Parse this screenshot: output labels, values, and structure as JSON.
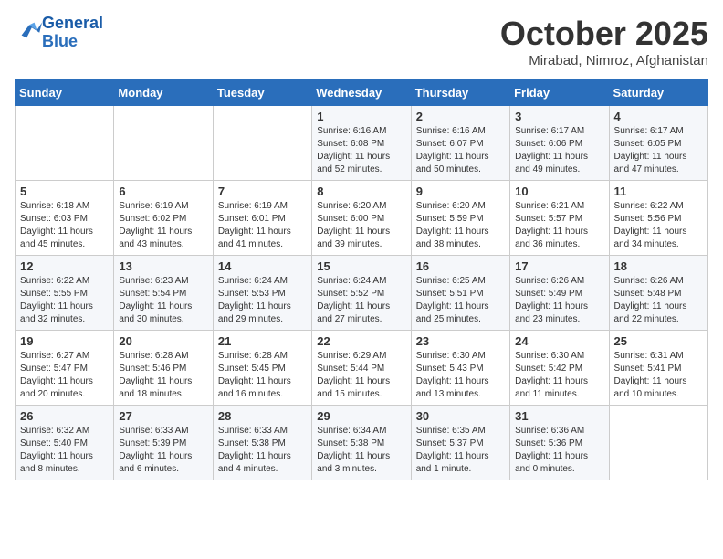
{
  "header": {
    "logo_line1": "General",
    "logo_line2": "Blue",
    "month": "October 2025",
    "location": "Mirabad, Nimroz, Afghanistan"
  },
  "weekdays": [
    "Sunday",
    "Monday",
    "Tuesday",
    "Wednesday",
    "Thursday",
    "Friday",
    "Saturday"
  ],
  "weeks": [
    [
      {
        "day": "",
        "info": ""
      },
      {
        "day": "",
        "info": ""
      },
      {
        "day": "",
        "info": ""
      },
      {
        "day": "1",
        "info": "Sunrise: 6:16 AM\nSunset: 6:08 PM\nDaylight: 11 hours\nand 52 minutes."
      },
      {
        "day": "2",
        "info": "Sunrise: 6:16 AM\nSunset: 6:07 PM\nDaylight: 11 hours\nand 50 minutes."
      },
      {
        "day": "3",
        "info": "Sunrise: 6:17 AM\nSunset: 6:06 PM\nDaylight: 11 hours\nand 49 minutes."
      },
      {
        "day": "4",
        "info": "Sunrise: 6:17 AM\nSunset: 6:05 PM\nDaylight: 11 hours\nand 47 minutes."
      }
    ],
    [
      {
        "day": "5",
        "info": "Sunrise: 6:18 AM\nSunset: 6:03 PM\nDaylight: 11 hours\nand 45 minutes."
      },
      {
        "day": "6",
        "info": "Sunrise: 6:19 AM\nSunset: 6:02 PM\nDaylight: 11 hours\nand 43 minutes."
      },
      {
        "day": "7",
        "info": "Sunrise: 6:19 AM\nSunset: 6:01 PM\nDaylight: 11 hours\nand 41 minutes."
      },
      {
        "day": "8",
        "info": "Sunrise: 6:20 AM\nSunset: 6:00 PM\nDaylight: 11 hours\nand 39 minutes."
      },
      {
        "day": "9",
        "info": "Sunrise: 6:20 AM\nSunset: 5:59 PM\nDaylight: 11 hours\nand 38 minutes."
      },
      {
        "day": "10",
        "info": "Sunrise: 6:21 AM\nSunset: 5:57 PM\nDaylight: 11 hours\nand 36 minutes."
      },
      {
        "day": "11",
        "info": "Sunrise: 6:22 AM\nSunset: 5:56 PM\nDaylight: 11 hours\nand 34 minutes."
      }
    ],
    [
      {
        "day": "12",
        "info": "Sunrise: 6:22 AM\nSunset: 5:55 PM\nDaylight: 11 hours\nand 32 minutes."
      },
      {
        "day": "13",
        "info": "Sunrise: 6:23 AM\nSunset: 5:54 PM\nDaylight: 11 hours\nand 30 minutes."
      },
      {
        "day": "14",
        "info": "Sunrise: 6:24 AM\nSunset: 5:53 PM\nDaylight: 11 hours\nand 29 minutes."
      },
      {
        "day": "15",
        "info": "Sunrise: 6:24 AM\nSunset: 5:52 PM\nDaylight: 11 hours\nand 27 minutes."
      },
      {
        "day": "16",
        "info": "Sunrise: 6:25 AM\nSunset: 5:51 PM\nDaylight: 11 hours\nand 25 minutes."
      },
      {
        "day": "17",
        "info": "Sunrise: 6:26 AM\nSunset: 5:49 PM\nDaylight: 11 hours\nand 23 minutes."
      },
      {
        "day": "18",
        "info": "Sunrise: 6:26 AM\nSunset: 5:48 PM\nDaylight: 11 hours\nand 22 minutes."
      }
    ],
    [
      {
        "day": "19",
        "info": "Sunrise: 6:27 AM\nSunset: 5:47 PM\nDaylight: 11 hours\nand 20 minutes."
      },
      {
        "day": "20",
        "info": "Sunrise: 6:28 AM\nSunset: 5:46 PM\nDaylight: 11 hours\nand 18 minutes."
      },
      {
        "day": "21",
        "info": "Sunrise: 6:28 AM\nSunset: 5:45 PM\nDaylight: 11 hours\nand 16 minutes."
      },
      {
        "day": "22",
        "info": "Sunrise: 6:29 AM\nSunset: 5:44 PM\nDaylight: 11 hours\nand 15 minutes."
      },
      {
        "day": "23",
        "info": "Sunrise: 6:30 AM\nSunset: 5:43 PM\nDaylight: 11 hours\nand 13 minutes."
      },
      {
        "day": "24",
        "info": "Sunrise: 6:30 AM\nSunset: 5:42 PM\nDaylight: 11 hours\nand 11 minutes."
      },
      {
        "day": "25",
        "info": "Sunrise: 6:31 AM\nSunset: 5:41 PM\nDaylight: 11 hours\nand 10 minutes."
      }
    ],
    [
      {
        "day": "26",
        "info": "Sunrise: 6:32 AM\nSunset: 5:40 PM\nDaylight: 11 hours\nand 8 minutes."
      },
      {
        "day": "27",
        "info": "Sunrise: 6:33 AM\nSunset: 5:39 PM\nDaylight: 11 hours\nand 6 minutes."
      },
      {
        "day": "28",
        "info": "Sunrise: 6:33 AM\nSunset: 5:38 PM\nDaylight: 11 hours\nand 4 minutes."
      },
      {
        "day": "29",
        "info": "Sunrise: 6:34 AM\nSunset: 5:38 PM\nDaylight: 11 hours\nand 3 minutes."
      },
      {
        "day": "30",
        "info": "Sunrise: 6:35 AM\nSunset: 5:37 PM\nDaylight: 11 hours\nand 1 minute."
      },
      {
        "day": "31",
        "info": "Sunrise: 6:36 AM\nSunset: 5:36 PM\nDaylight: 11 hours\nand 0 minutes."
      },
      {
        "day": "",
        "info": ""
      }
    ]
  ]
}
